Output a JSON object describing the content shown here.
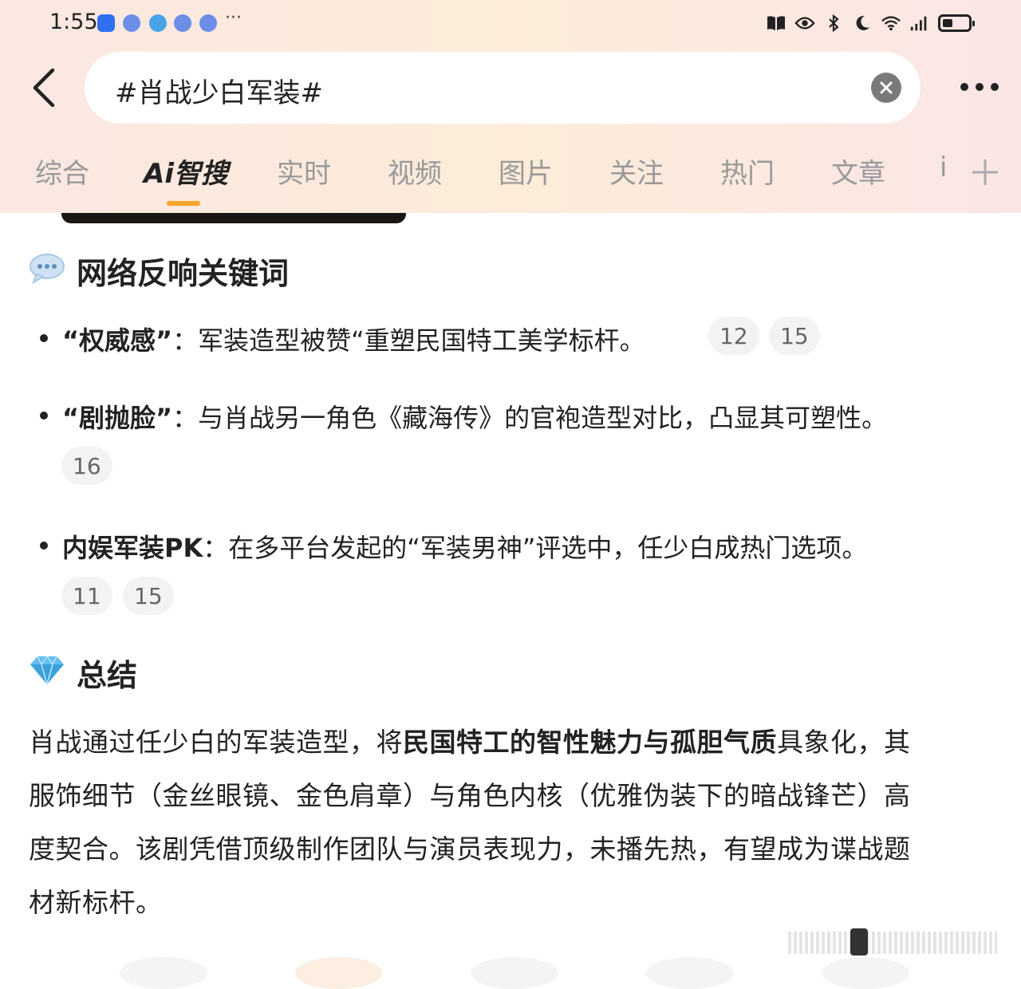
{
  "status_bar": {
    "time": "1:55",
    "overflow": "···"
  },
  "search": {
    "query": "#肖战少白军装#"
  },
  "tabs": [
    {
      "label": "综合"
    },
    {
      "label": "Ai智搜",
      "active": true
    },
    {
      "label": "实时"
    },
    {
      "label": "视频"
    },
    {
      "label": "图片"
    },
    {
      "label": "关注"
    },
    {
      "label": "热门"
    },
    {
      "label": "文章"
    },
    {
      "label": "i"
    }
  ],
  "keywords_section": {
    "title": "网络反响关键词",
    "items": [
      {
        "keyword": "“权威感”",
        "text": "：军装造型被赞“重塑民国特工美学标杆。",
        "refs": [
          "12",
          "15"
        ]
      },
      {
        "keyword": "“剧抛脸”",
        "text": "：与肖战另一角色《藏海传》的官袍造型对比，凸显其可塑性。",
        "refs": [
          "16"
        ]
      },
      {
        "keyword": "内娱军装PK",
        "text": "：在多平台发起的“军装男神”评选中，任少白成热门选项。",
        "refs": [
          "11",
          "15"
        ]
      }
    ]
  },
  "summary_section": {
    "title": "总结",
    "line1_a": "肖战通过任少白的军装造型，将",
    "line1_bold": "民国特工的智性魅力与孤胆气质",
    "line1_b": "具象化，其",
    "line2": "服饰细节（金丝眼镜、金色肩章）与角色内核（优雅伪装下的暗战锋芒）高",
    "line3": "度契合。该剧凭借顶级制作团队与演员表现力，未播先热，有望成为谍战题",
    "line4": "材新标杆。"
  }
}
